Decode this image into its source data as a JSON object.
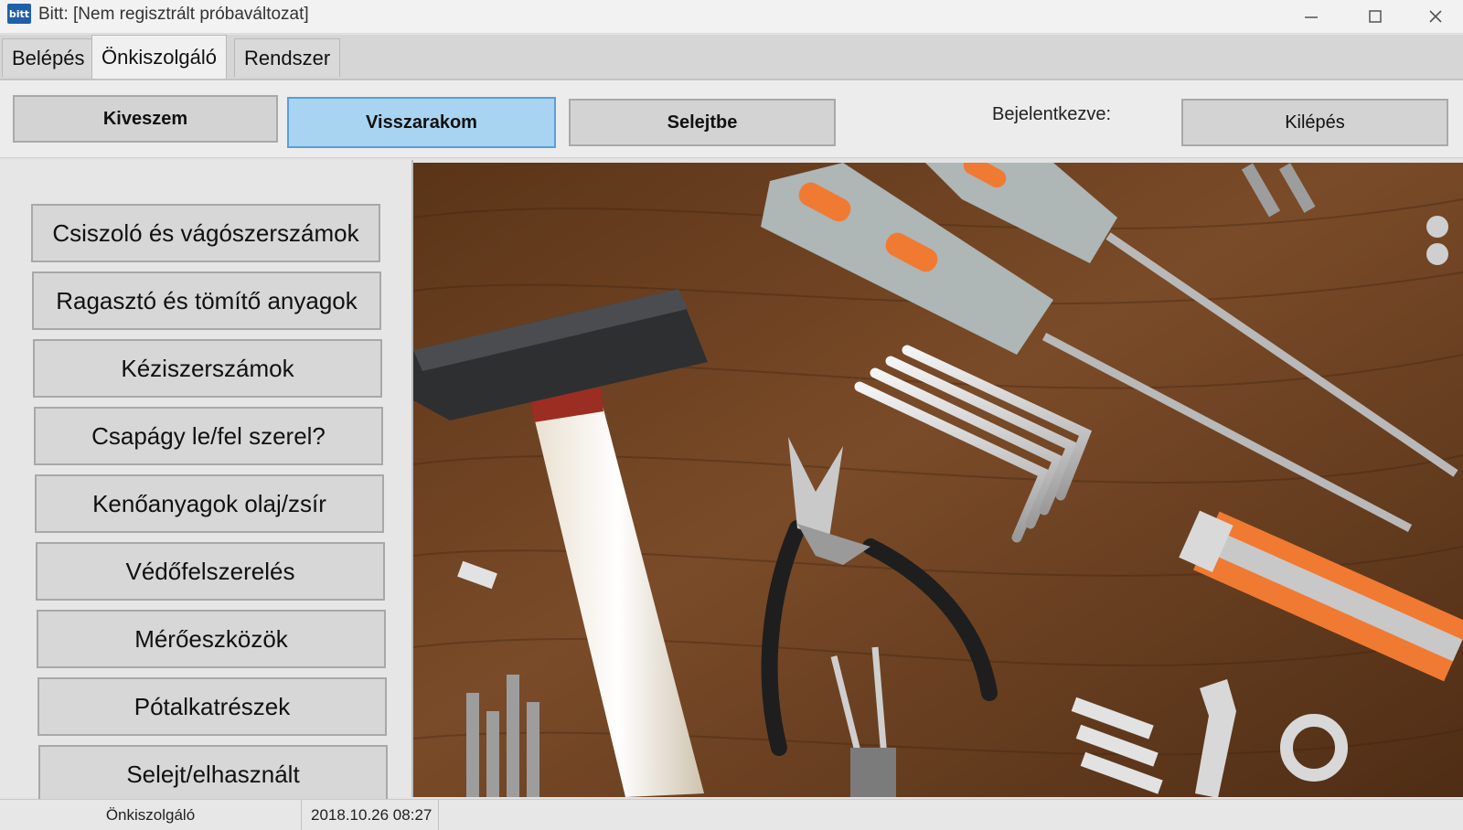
{
  "window": {
    "icon_text": "bitt",
    "title": "Bitt: [Nem regisztrált próbaváltozat]",
    "minimize_icon": "minimize-icon",
    "maximize_icon": "maximize-icon",
    "close_icon": "close-icon"
  },
  "menu": {
    "tabs": [
      {
        "label": "Belépés"
      },
      {
        "label": "Önkiszolgáló"
      },
      {
        "label": "Rendszer"
      }
    ],
    "active_index": 1
  },
  "toolbar": {
    "take_label": "Kiveszem",
    "return_label": "Visszarakom",
    "scrap_label": "Selejtbe",
    "logged_in_label": "Bejelentkezve:",
    "logout_label": "Kilépés",
    "selected": "Visszarakom",
    "selected_color": "#a9d4f1"
  },
  "categories": [
    {
      "label": "Csiszoló és vágószerszámok"
    },
    {
      "label": "Ragasztó és tömítő anyagok"
    },
    {
      "label": "Kéziszerszámok"
    },
    {
      "label": "Csapágy le/fel szerel?"
    },
    {
      "label": "Kenőanyagok olaj/zsír"
    },
    {
      "label": "Védőfelszerelés"
    },
    {
      "label": "Mérőeszközök"
    },
    {
      "label": "Pótalkatrészek"
    },
    {
      "label": "Selejt/elhasznált"
    }
  ],
  "status": {
    "mode": "Önkiszolgáló",
    "datetime": "2018.10.26 08:27"
  },
  "colors": {
    "wood": "#6e4424",
    "accent_orange": "#f07a32"
  }
}
